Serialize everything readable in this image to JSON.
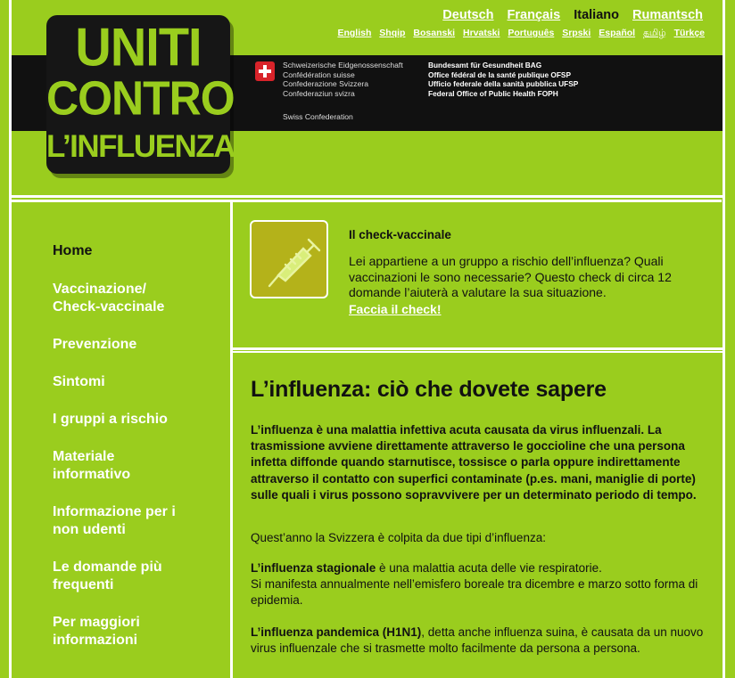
{
  "logo": {
    "line1": "UNITI",
    "line2": "CONTRO",
    "line3": "L’INFLUENZA"
  },
  "header": {
    "confederation": [
      "Schweizerische Eidgenossenschaft",
      "Confédération suisse",
      "Confederazione Svizzera",
      "Confederaziun svizra"
    ],
    "confederation_en": "Swiss Confederation",
    "office": [
      "Bundesamt für Gesundheit BAG",
      "Office fédéral de la santé publique OFSP",
      "Ufficio federale della sanità pubblica UFSP",
      "Federal Office of Public Health FOPH"
    ]
  },
  "languages": {
    "main": [
      {
        "label": "Deutsch",
        "current": false
      },
      {
        "label": "Français",
        "current": false
      },
      {
        "label": "Italiano",
        "current": true
      },
      {
        "label": "Rumantsch",
        "current": false
      }
    ],
    "more": [
      "English",
      "Shqip",
      "Bosanski",
      "Hrvatski",
      "Português",
      "Srpski",
      "Español",
      "தமிழ்",
      "Türkçe"
    ]
  },
  "nav": [
    {
      "label": "Home",
      "active": true
    },
    {
      "label": "Vaccinazione/ Check-vaccinale",
      "active": false
    },
    {
      "label": "Prevenzione",
      "active": false
    },
    {
      "label": "Sintomi",
      "active": false
    },
    {
      "label": "I gruppi a rischio",
      "active": false
    },
    {
      "label": "Materiale informativo",
      "active": false
    },
    {
      "label": "Informazione per i non udenti",
      "active": false
    },
    {
      "label": "Le domande più frequenti",
      "active": false
    },
    {
      "label": "Per maggiori informazioni",
      "active": false
    }
  ],
  "check": {
    "title": "Il check-vaccinale",
    "text": "Lei appartiene a un gruppo a rischio dell’influenza? Quali vaccinazioni le sono necessarie? Questo check di circa 12 domande l’aiuterà a valutare la sua situazione.",
    "link": "Faccia il check!",
    "icon": "syringe-icon"
  },
  "article": {
    "title": "L’influenza: ciò che dovete sapere",
    "intro": "L’influenza è una malattia infettiva acuta causata da virus influenzali. La trasmissione avviene direttamente attraverso le goccioline che una persona infetta diffonde quando starnutisce, tossisce o parla oppure indirettamente attraverso il contatto con superfici contaminate (p.es. mani, maniglie di porte) sulle quali i virus possono sopravvivere per un determinato periodo di tempo.",
    "p1": "Quest’anno la Svizzera è colpita da due tipi d’influenza:",
    "p2_bold": "L’influenza stagionale",
    "p2_rest": " è una malattia acuta delle vie respiratorie.",
    "p2_line2": "Si manifesta annualmente nell’emisfero boreale tra dicembre e marzo sotto forma di epidemia.",
    "p3_bold": "L’influenza pandemica (H1N1)",
    "p3_rest": ", detta anche influenza suina, è causata da un nuovo virus influenzale che si trasmette molto facilmente da persona a persona."
  },
  "colors": {
    "background": "#9acd1e",
    "header_band": "#111111",
    "link": "#ffffff",
    "swiss_red": "#d8232a"
  }
}
